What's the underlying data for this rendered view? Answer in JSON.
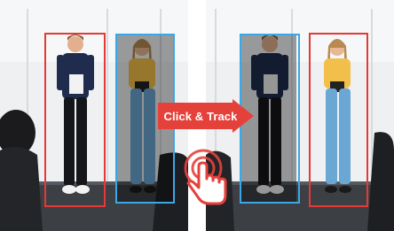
{
  "action": {
    "label": "Click & Track",
    "arrow_color": "#e5413b"
  },
  "icons": {
    "cursor": "tap-hand-icon"
  },
  "colors": {
    "highlight_box": "#e53935",
    "secondary_box": "#3aa8e6"
  }
}
